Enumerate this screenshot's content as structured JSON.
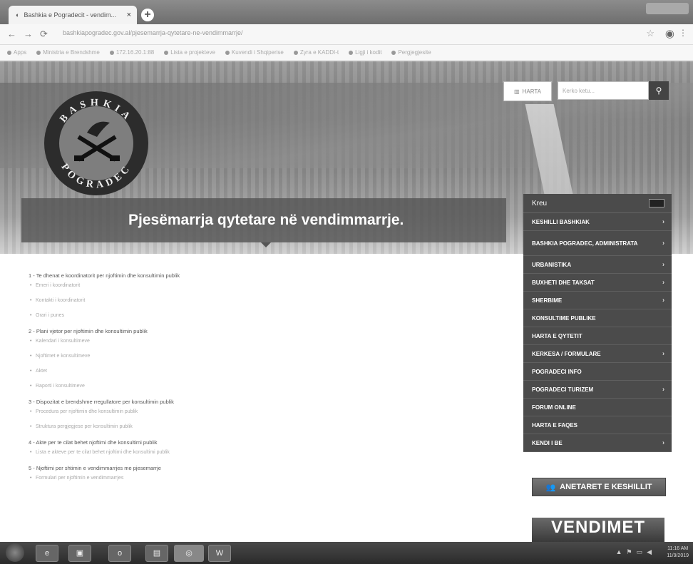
{
  "browser": {
    "tab_title": "Bashkia e Pogradecit - vendim...",
    "url": "bashkiapogradec.gov.al/pjesemarrja-qytetare-ne-vendimmarrje/",
    "bookmarks": [
      "Apps",
      "Ministria e Brendshme",
      "172.16.20.1:88",
      "Lista e projekteve",
      "Kuvendi i Shqiperise",
      "Zyra e KADDI-t",
      "Ligji i kodit",
      "Pergjegjesite"
    ]
  },
  "header": {
    "map_button": "HARTA",
    "search_placeholder": "Kerko ketu...",
    "logo_text_top": "BASHKIA",
    "logo_text_bottom": "POGRADEC"
  },
  "page_title": "Pjesëmarrja qytetare në vendimmarrje.",
  "sidemenu": {
    "heading": "Kreu",
    "items": [
      {
        "label": "KESHILLI BASHKIAK",
        "chevron": true
      },
      {
        "label": "BASHKIA POGRADEC, ADMINISTRATA",
        "chevron": true
      },
      {
        "label": "URBANISTIKA",
        "chevron": true
      },
      {
        "label": "BUXHETI DHE TAKSAT",
        "chevron": true
      },
      {
        "label": "SHERBIME",
        "chevron": true
      },
      {
        "label": "KONSULTIME PUBLIKE",
        "chevron": false
      },
      {
        "label": "HARTA E QYTETIT",
        "chevron": false
      },
      {
        "label": "KERKESA / FORMULARE",
        "chevron": true
      },
      {
        "label": "POGRADECI INFO",
        "chevron": false
      },
      {
        "label": "POGRADECI TURIZEM",
        "chevron": true
      },
      {
        "label": "FORUM ONLINE",
        "chevron": false
      },
      {
        "label": "HARTA E FAQES",
        "chevron": false
      },
      {
        "label": "KENDI I BE",
        "chevron": true
      }
    ]
  },
  "content": {
    "sections": [
      {
        "title": "1 - Te dhenat e koordinatorit per njoftimin dhe konsultimin publik",
        "links": [
          "Emeri i koordinatorit",
          "Kontakti i koordinatorit",
          "Orari i punes"
        ]
      },
      {
        "title": "2 - Plani vjetor per njoftimin dhe konsultimin publik",
        "links": [
          "Kalendari i konsultimeve",
          "Njoftimet e konsultimeve",
          "Aktet",
          "Raporti i konsultimeve"
        ]
      },
      {
        "title": "3 - Dispozitat e brendshme rregullatore per konsultimin publik",
        "links": [
          "Procedura per njoftimin dhe konsultimin publik",
          "Struktura pergjegjese per konsultimin publik"
        ]
      },
      {
        "title": "4 - Akte per te cilat behet njoftimi dhe konsultimi publik",
        "links": [
          "Lista e akteve per te cilat behet njoftimi dhe konsultimi publik"
        ]
      },
      {
        "title": "5 - Njoftimi per shtimin e vendimmarrjes me pjesemarrje",
        "links": [
          "Formulari per njoftimin e vendimmarrjes"
        ]
      }
    ]
  },
  "banners": {
    "council_members": "ANETARET E KESHILLIT",
    "decisions": "VENDIMET"
  },
  "taskbar": {
    "time": "11:16 AM",
    "date": "11/9/2019"
  },
  "icons": {
    "search": "search-icon",
    "map": "map-icon",
    "chevron": "chevron-right-icon",
    "flag": "flag-icon"
  }
}
